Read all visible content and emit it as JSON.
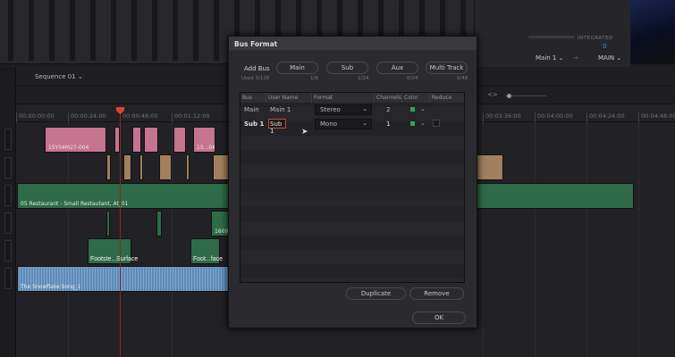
{
  "sequence": {
    "name": "Sequence 01"
  },
  "meters": {
    "integrated_label": "INTEGRATED",
    "integrated_value": "0",
    "source": "Main 1",
    "destination": "MAIN"
  },
  "ruler": {
    "timecodes": [
      "00:00:00:00",
      "00:00:24:00",
      "00:00:48:00",
      "00:01:12:00",
      "00:03:36:00",
      "00:04:00:00",
      "00:04:24:00",
      "00:04:48:00"
    ]
  },
  "clips": {
    "v1_a": "15Y04M27-004",
    "v1_b": "15...04",
    "a1": "05 Restaurant - Small Restautant, At_01",
    "a2": "16092",
    "a3_a": "Footste...Surface",
    "a3_b": "Foot...face",
    "a4": "The Snowflake Song_1"
  },
  "dialog": {
    "title": "Bus Format",
    "add_bus_label": "Add Bus",
    "used": "Used 3/128",
    "buttons": [
      {
        "label": "Main",
        "count": "1/8"
      },
      {
        "label": "Sub",
        "count": "1/24"
      },
      {
        "label": "Aux",
        "count": "0/24"
      },
      {
        "label": "Multi Track",
        "count": "0/48"
      }
    ],
    "columns": [
      "Bus",
      "User Name",
      "Format",
      "Channels",
      "Color",
      "Reduce"
    ],
    "rows": [
      {
        "bus": "Main",
        "user_name": "Main 1",
        "format": "Stereo",
        "channels": "2",
        "color": "#2fa35a"
      },
      {
        "bus": "Sub 1",
        "user_name": "Sub 1",
        "format": "Mono",
        "channels": "1",
        "color": "#2fa35a",
        "reduce": false
      }
    ],
    "duplicate": "Duplicate",
    "remove": "Remove",
    "ok": "OK"
  },
  "colors": {
    "playhead": "#d9452a",
    "video_clip": "#c6738f",
    "orange_clip": "#a27f5e",
    "audio_green": "#2f6b48",
    "audio_blue": "#5f8bb8"
  }
}
